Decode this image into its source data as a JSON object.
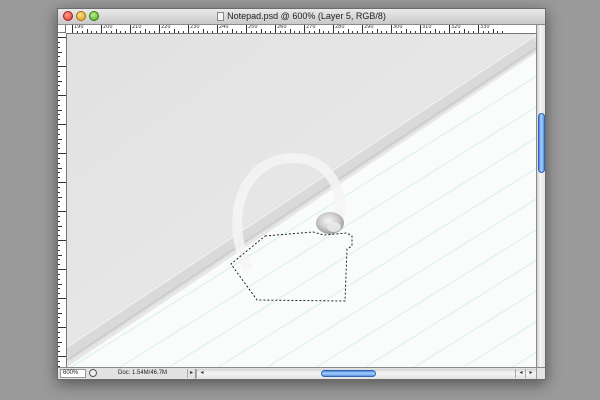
{
  "window": {
    "title": "Notepad.psd @ 600% (Layer 5, RGB/8)"
  },
  "ruler": {
    "top_labels": [
      "190",
      "200",
      "210",
      "220",
      "230",
      "240",
      "250",
      "260",
      "270",
      "280",
      "290",
      "300",
      "310",
      "320",
      "330"
    ]
  },
  "status": {
    "zoom": "600%",
    "doc": "Doc: 1.54M/46.7M"
  },
  "icons": {
    "close": "close-button-icon",
    "minimize": "minimize-button-icon",
    "zoom": "zoom-button-icon",
    "navigator": "navigator-icon"
  },
  "colors": {
    "close": "#d8352a",
    "minimize": "#d99c12",
    "zoom": "#4ea51f",
    "scroll_thumb": "#5a94e0",
    "paper_line": "#d6eef0"
  }
}
